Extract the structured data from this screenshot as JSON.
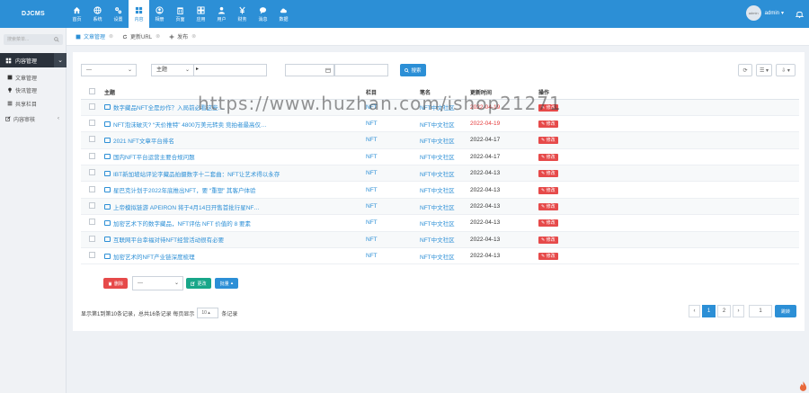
{
  "app": {
    "logo": "DJCMS"
  },
  "nav": [
    {
      "label": "首页",
      "icon": "home-icon"
    },
    {
      "label": "系统",
      "icon": "globe-icon"
    },
    {
      "label": "设置",
      "icon": "gear-icon"
    },
    {
      "label": "内容",
      "icon": "grid-icon",
      "active": true
    },
    {
      "label": "相册",
      "icon": "user-circle-icon"
    },
    {
      "label": "页面",
      "icon": "trash-icon"
    },
    {
      "label": "应用",
      "icon": "apps-icon"
    },
    {
      "label": "用户",
      "icon": "users-icon"
    },
    {
      "label": "财务",
      "icon": "yen-icon"
    },
    {
      "label": "消息",
      "icon": "chat-icon"
    },
    {
      "label": "数据",
      "icon": "cloud-icon"
    }
  ],
  "user": {
    "name": "admin",
    "avatar_text": "admin",
    "caret": "▾"
  },
  "sidebar": {
    "search_placeholder": "搜索菜单...",
    "active_menu": "内容管理",
    "items": [
      {
        "label": "文章管理",
        "icon": "file-icon"
      },
      {
        "label": "快讯管理",
        "icon": "bulb-icon"
      },
      {
        "label": "共享栏目",
        "icon": "list-icon"
      },
      {
        "label": "内容审核",
        "icon": "edit-icon",
        "arrow": "‹"
      }
    ]
  },
  "breadcrumb": [
    {
      "label": "文章管理",
      "close": "⊗"
    },
    {
      "label": "更新URL",
      "close": "⊗"
    },
    {
      "label": "发布",
      "close": "⊗"
    }
  ],
  "filters": {
    "select1": "---",
    "select2": "主题",
    "arrow": "▸",
    "search_btn": "搜索"
  },
  "toolbar": {
    "btn1": "⟳",
    "btn2": "☰ ▾",
    "btn3": "⇩ ▾"
  },
  "table": {
    "headers": [
      "主题",
      "栏目",
      "笔名",
      "更新时间",
      "操作"
    ],
    "rows": [
      {
        "title": "数字藏品NFT全是炒作？入局前必看这些…",
        "cat": "NFT",
        "author": "NFT中文社区",
        "date": "2022-04-19",
        "red": true
      },
      {
        "title": "NFT泡沫破灭? “天价推特” 4800万美元转卖 竞拍者最高仅…",
        "cat": "NFT",
        "author": "NFT中文社区",
        "date": "2022-04-19",
        "red": true
      },
      {
        "title": "2021 NFT文章平台排名",
        "cat": "NFT",
        "author": "NFT中文社区",
        "date": "2022-04-17",
        "red": false
      },
      {
        "title": "国内NFT平台运营主要合规问题",
        "cat": "NFT",
        "author": "NFT中文社区",
        "date": "2022-04-17",
        "red": false
      },
      {
        "title": "IBT新加坡站评论字藏品拍摄数字十二套曲：NFT让艺术得以永存",
        "cat": "NFT",
        "author": "NFT中文社区",
        "date": "2022-04-13",
        "red": false
      },
      {
        "title": "星巴克计划于2022年底推出NFT，要 “重塑” 其客户体验",
        "cat": "NFT",
        "author": "NFT中文社区",
        "date": "2022-04-13",
        "red": false
      },
      {
        "title": "上帝模拟链游 APEIRON 将于4月14日开售首批行星NF…",
        "cat": "NFT",
        "author": "NFT中文社区",
        "date": "2022-04-13",
        "red": false
      },
      {
        "title": "加密艺术下的数字藏品，NFT评估 NFT 价值的 8 要素",
        "cat": "NFT",
        "author": "NFT中文社区",
        "date": "2022-04-13",
        "red": false
      },
      {
        "title": "互联网平台幸福对待NFT经营活动很有必要",
        "cat": "NFT",
        "author": "NFT中文社区",
        "date": "2022-04-13",
        "red": false
      },
      {
        "title": "加密艺术的NFT产业链深度梳理",
        "cat": "NFT",
        "author": "NFT中文社区",
        "date": "2022-04-13",
        "red": false
      }
    ],
    "edit_label": "修改"
  },
  "bulk": {
    "delete": "删除",
    "select": "---",
    "change": "更改",
    "batch": "批量"
  },
  "pagination": {
    "info_prefix": "显示第1到第10条记录，总共16条记录 每页显示",
    "page_size": "10",
    "info_suffix": "条记录",
    "prev": "‹",
    "pages": [
      "1",
      "2"
    ],
    "next": "›",
    "jump_value": "1",
    "jump_btn": "跳转"
  },
  "watermark": "https://www.huzhan.com/ishop21271",
  "colors": {
    "primary": "#2c8fd6",
    "danger": "#e64a4a",
    "success": "#18a689",
    "sidebar_dark": "#2a313b"
  }
}
